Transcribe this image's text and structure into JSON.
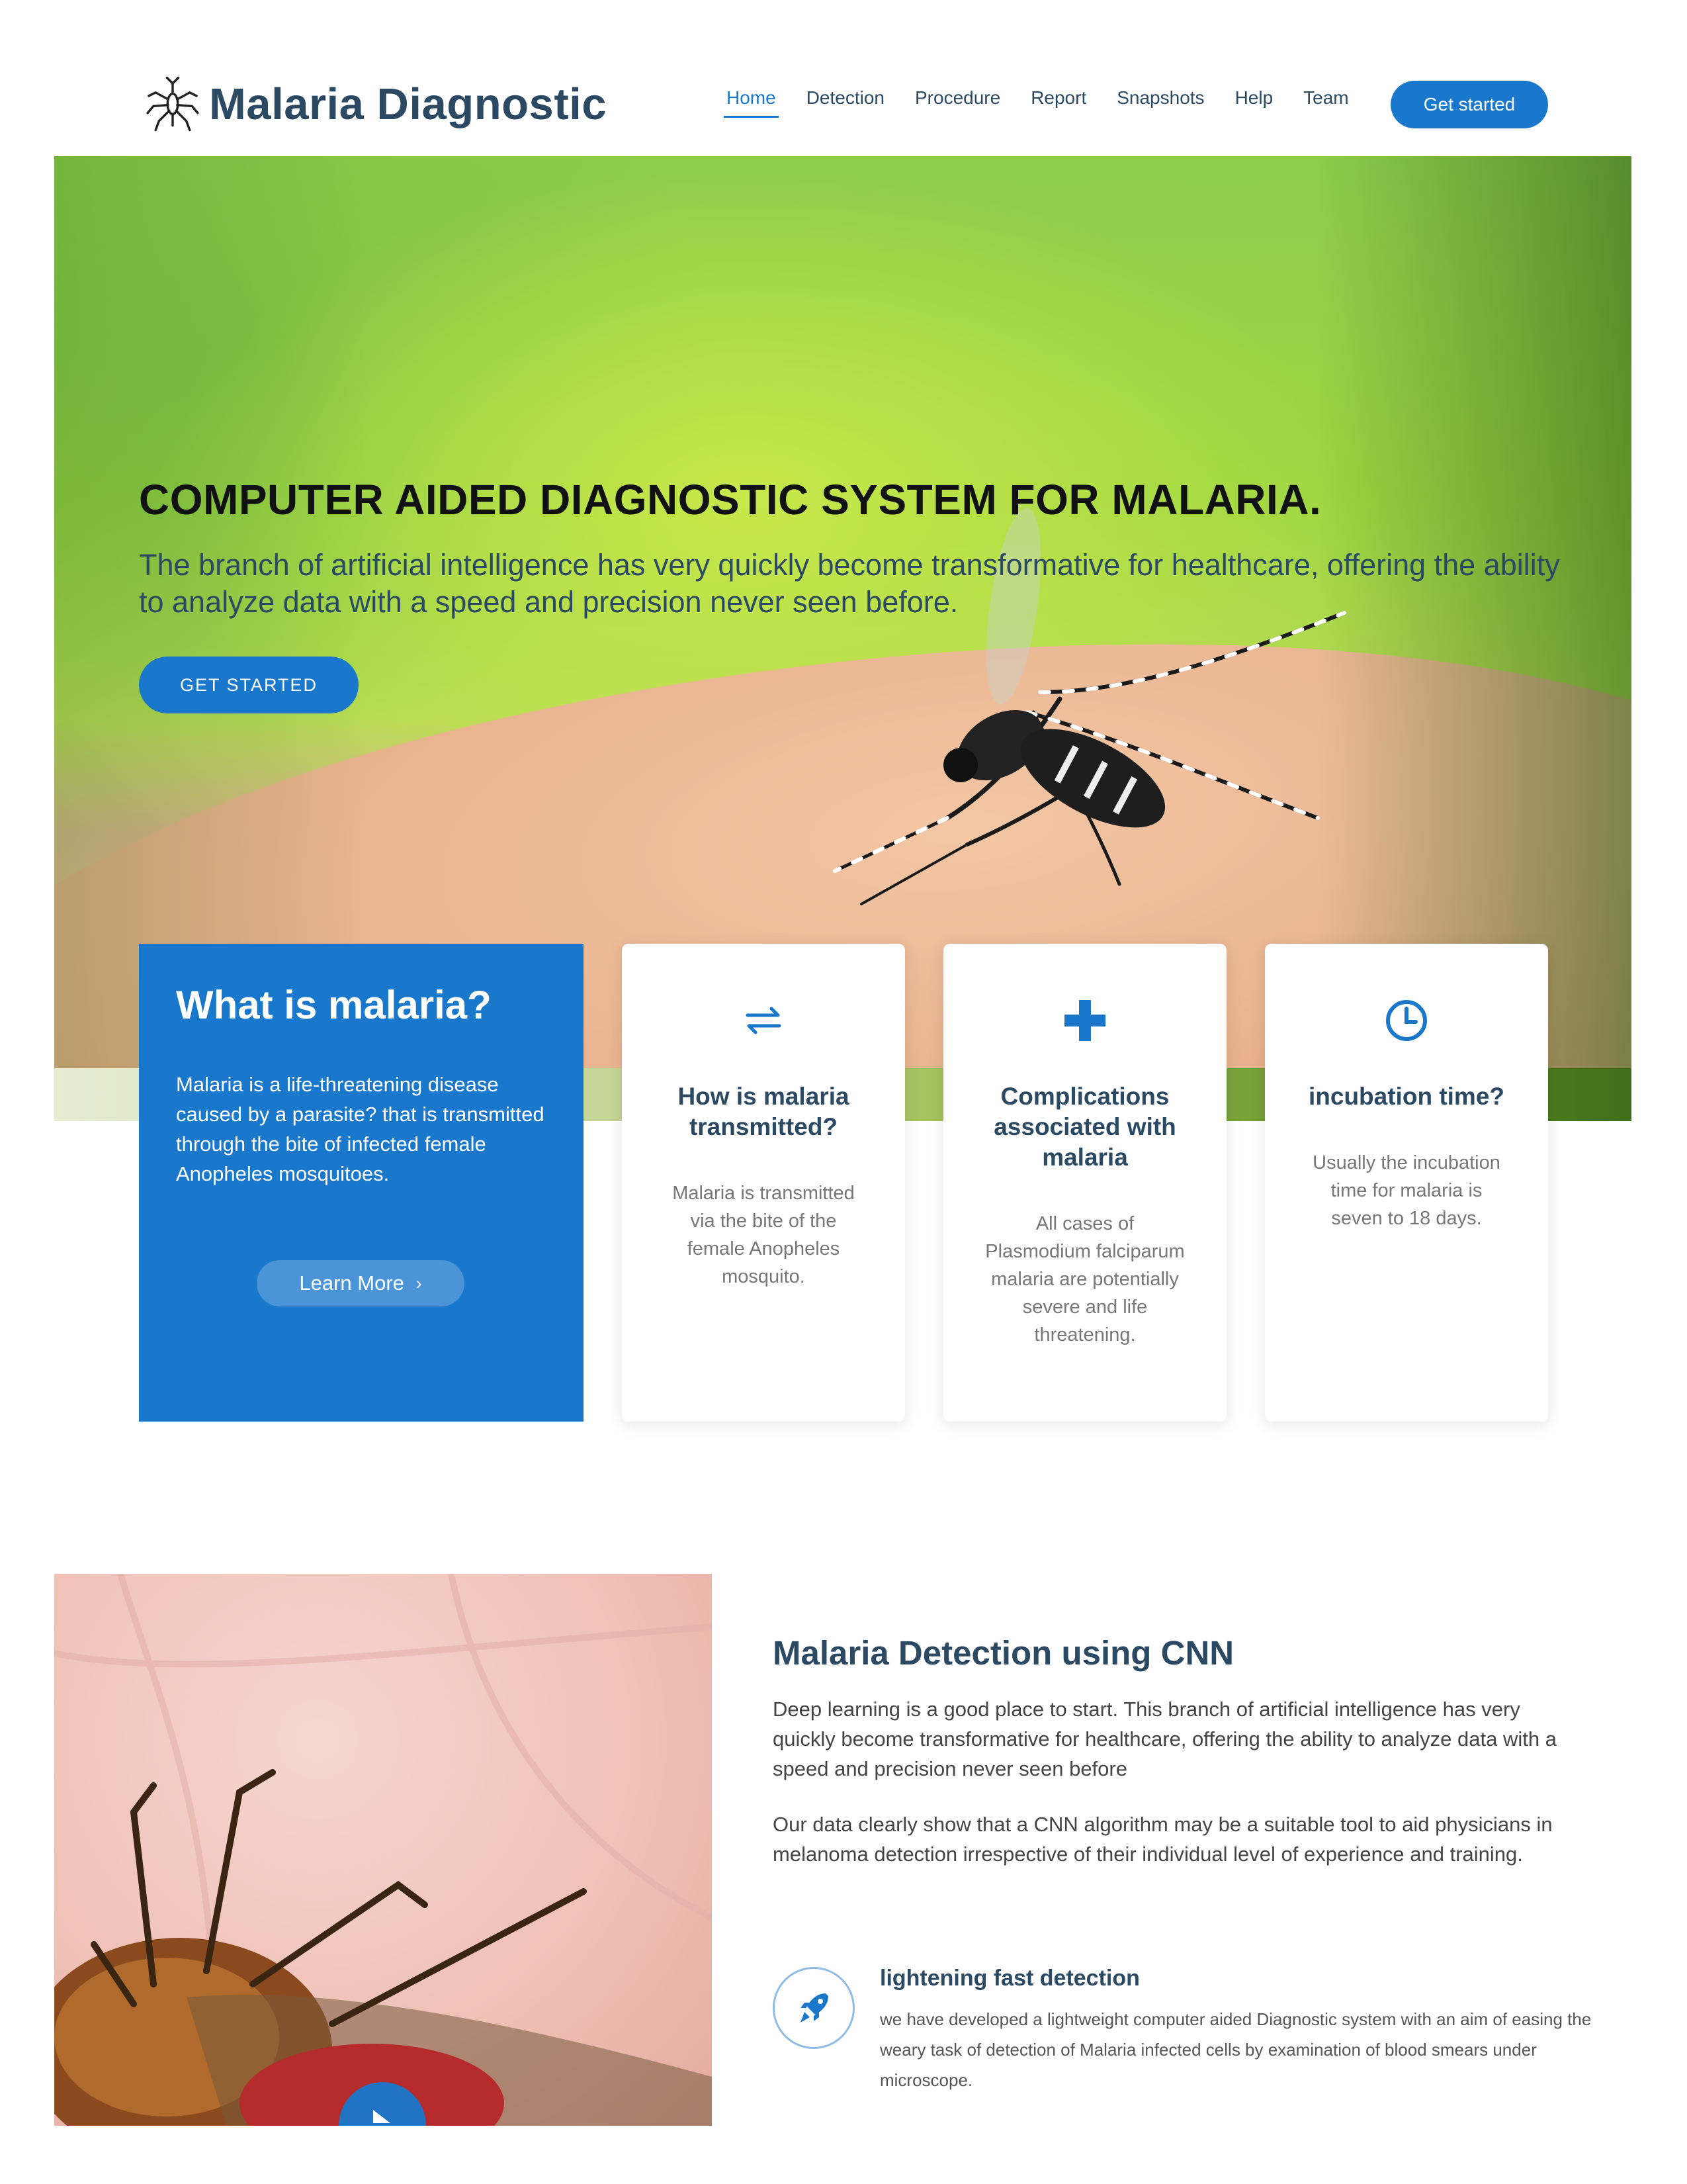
{
  "header": {
    "brand": "Malaria Diagnostic",
    "nav": [
      "Home",
      "Detection",
      "Procedure",
      "Report",
      "Snapshots",
      "Help",
      "Team"
    ],
    "active": "Home",
    "cta": "Get started"
  },
  "hero": {
    "title": "COMPUTER AIDED DIAGNOSTIC SYSTEM FOR MALARIA.",
    "subtitle": "The branch of artificial intelligence has very quickly become transformative for healthcare, offering the ability to analyze data with a speed and precision never seen before.",
    "button": "GET STARTED"
  },
  "cards": {
    "main": {
      "title": "What is malaria?",
      "text": "Malaria is a life-threatening disease caused by a parasite? that is transmitted through the bite of infected female Anopheles mosquitoes.",
      "button": "Learn More",
      "button_icon": "chevron-right-icon"
    },
    "items": [
      {
        "icon": "arrows-exchange-icon",
        "title": "How is malaria transmitted?",
        "text": "Malaria is transmitted via the bite of the female Anopheles mosquito."
      },
      {
        "icon": "plus-icon",
        "title": "Complications associated with malaria",
        "text": "All cases of Plasmodium falciparum malaria are potentially severe and life threatening."
      },
      {
        "icon": "clock-icon",
        "title": "incubation time?",
        "text": "Usually the incubation time for malaria is seven to 18 days."
      }
    ]
  },
  "about": {
    "title": "Malaria Detection using CNN",
    "p1": "Deep learning is a good place to start. This branch of artificial intelligence has very quickly become transformative for healthcare, offering the ability to analyze data with a speed and precision never seen before",
    "p2": "Our data clearly show that a CNN algorithm may be a suitable tool to aid physicians in melanoma detection irrespective of their individual level of experience and training.",
    "feature": {
      "icon": "rocket-icon",
      "title": "lightening fast detection",
      "text": "we have developed a lightweight computer aided Diagnostic system with an aim of easing the weary task of detection of Malaria infected cells by examination of blood smears under microscope."
    },
    "video_icon": "play-icon"
  },
  "colors": {
    "primary": "#1977cc",
    "heading": "#2c4964",
    "text": "#444444"
  }
}
